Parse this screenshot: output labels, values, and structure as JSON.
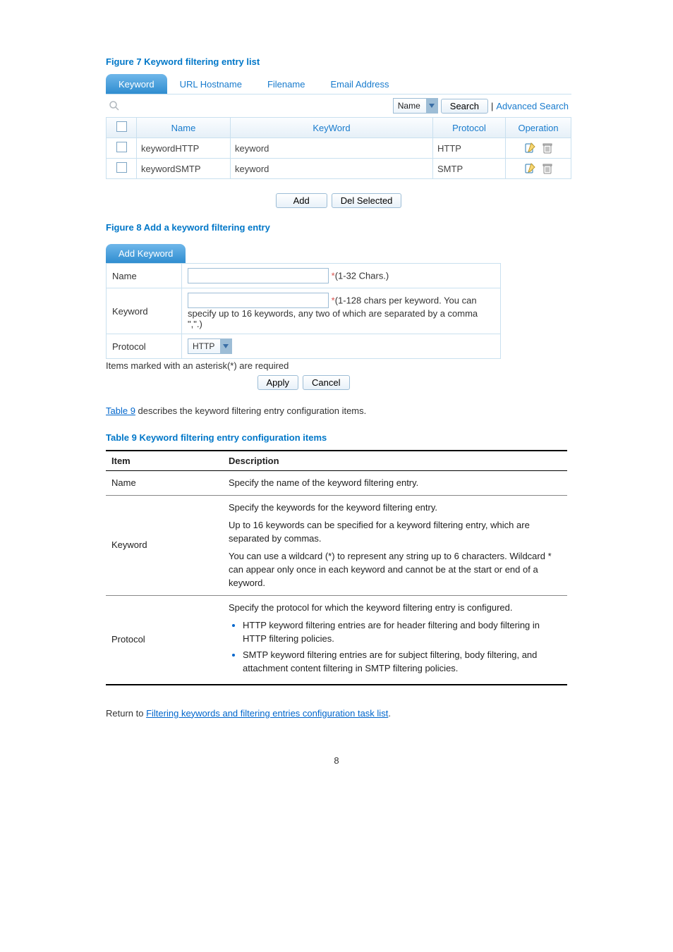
{
  "fig7": {
    "caption": "Figure 7 Keyword filtering entry list",
    "tabs": [
      "Keyword",
      "URL Hostname",
      "Filename",
      "Email Address"
    ],
    "search_field_select": "Name",
    "search_btn": "Search",
    "adv_search": "Advanced Search",
    "headers": {
      "name": "Name",
      "keyword": "KeyWord",
      "protocol": "Protocol",
      "operation": "Operation"
    },
    "rows": [
      {
        "name": "keywordHTTP",
        "keyword": "keyword",
        "protocol": "HTTP"
      },
      {
        "name": "keywordSMTP",
        "keyword": "keyword",
        "protocol": "SMTP"
      }
    ],
    "add_btn": "Add",
    "del_btn": "Del Selected"
  },
  "fig8": {
    "caption": "Figure 8 Add a keyword filtering entry",
    "tab": "Add Keyword",
    "labels": {
      "name": "Name",
      "keyword": "Keyword",
      "protocol": "Protocol"
    },
    "hints": {
      "name": "(1-32 Chars.)",
      "keyword": "(1-128 chars per keyword. You can specify up to 16 keywords, any two of which are separated by a comma \",\".)"
    },
    "protocol_value": "HTTP",
    "required_note": "Items marked with an asterisk(*) are required",
    "apply": "Apply",
    "cancel": "Cancel"
  },
  "intro": {
    "link": "Table 9",
    "text_after": " describes the keyword filtering entry configuration items."
  },
  "table9": {
    "caption": "Table 9 Keyword filtering entry configuration items",
    "headers": {
      "item": "Item",
      "desc": "Description"
    },
    "rows": {
      "name": {
        "item": "Name",
        "desc": "Specify the name of the keyword filtering entry."
      },
      "keyword": {
        "item": "Keyword",
        "p1": "Specify the keywords for the keyword filtering entry.",
        "p2": "Up to 16 keywords can be specified for a keyword filtering entry, which are separated by commas.",
        "p3": "You can use a wildcard (*) to represent any string up to 6 characters. Wildcard * can appear only once in each keyword and cannot be at the start or end of a keyword."
      },
      "protocol": {
        "item": "Protocol",
        "p1": "Specify the protocol for which the keyword filtering entry is configured.",
        "b1": "HTTP keyword filtering entries are for header filtering and body filtering in HTTP filtering policies.",
        "b2": "SMTP keyword filtering entries are for subject filtering, body filtering, and attachment content filtering in SMTP filtering policies."
      }
    }
  },
  "return_line": {
    "prefix": "Return to ",
    "link": "Filtering keywords and filtering entries configuration task list",
    "suffix": "."
  },
  "page_number": "8"
}
